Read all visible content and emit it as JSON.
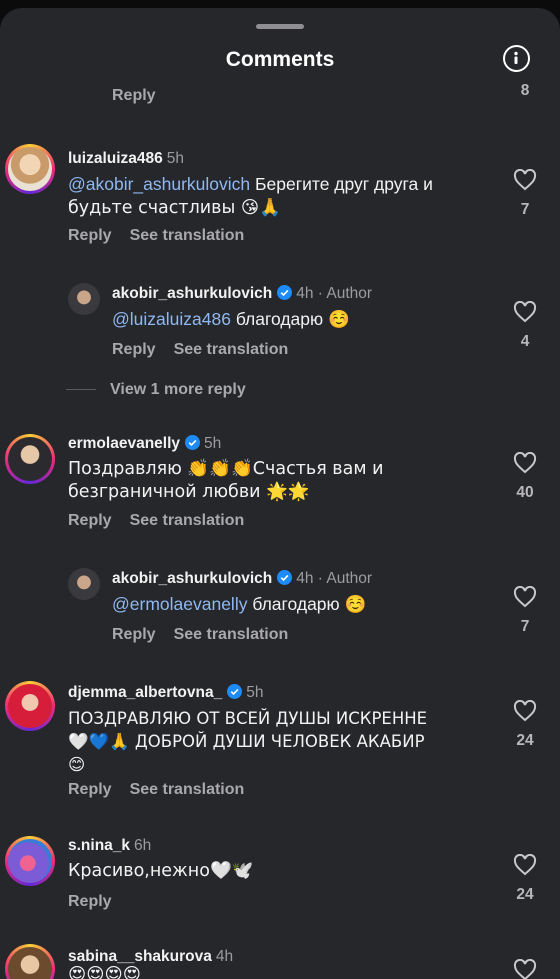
{
  "header": {
    "title": "Comments"
  },
  "top": {
    "reply": "Reply",
    "count": "8"
  },
  "comments": [
    {
      "username": "luizaluiza486",
      "time": "5h",
      "text_line1_mention": "@akobir_ashurkulovich",
      "text_line1_rest": " Берегите друг друга и",
      "text_line2": "будьте счастливы 😘🙏",
      "reply": "Reply",
      "translate": "See translation",
      "likes": "7"
    },
    {
      "username": "akobir_ashurkulovich",
      "time": "4h",
      "author": " · Author",
      "mention": "@luizaluiza486",
      "rest": " благодарю ☺️",
      "reply": "Reply",
      "translate": "See translation",
      "likes": "4"
    },
    {
      "more_replies": "View 1 more reply"
    },
    {
      "username": "ermolaevanelly",
      "time": "5h",
      "text_line1": "Поздравляю 👏👏👏Счастья вам и",
      "text_line2": "безграничной любви 🌟🌟",
      "reply": "Reply",
      "translate": "See translation",
      "likes": "40"
    },
    {
      "username": "akobir_ashurkulovich",
      "time": "4h",
      "author": " · Author",
      "mention": "@ermolaevanelly",
      "rest": " благодарю ☺️",
      "reply": "Reply",
      "translate": "See translation",
      "likes": "7"
    },
    {
      "username": "djemma_albertovna_",
      "time": "5h",
      "text_line1": "ПОЗДРАВЛЯЮ  ОТ ВСЕЙ ДУШЫ  ИСКРЕННЕ",
      "text_line2": "🤍💙🙏 ДОБРОЙ ДУШИ ЧЕЛОВЕК  АКАБИР",
      "text_line3": "😊",
      "reply": "Reply",
      "translate": "See translation",
      "likes": "24"
    },
    {
      "username": "s.nina_k",
      "time": "6h",
      "text_line1": "Красиво,нежно🤍🕊️",
      "reply": "Reply",
      "likes": "24"
    },
    {
      "username": "sabina__shakurova",
      "time": "4h",
      "text_line1": "😍😍😍😍"
    }
  ],
  "colors": {
    "sheet": "#26272b",
    "mention": "#8fb8f2",
    "verified": "#1d8cf8",
    "muted": "#a8a8ad"
  }
}
